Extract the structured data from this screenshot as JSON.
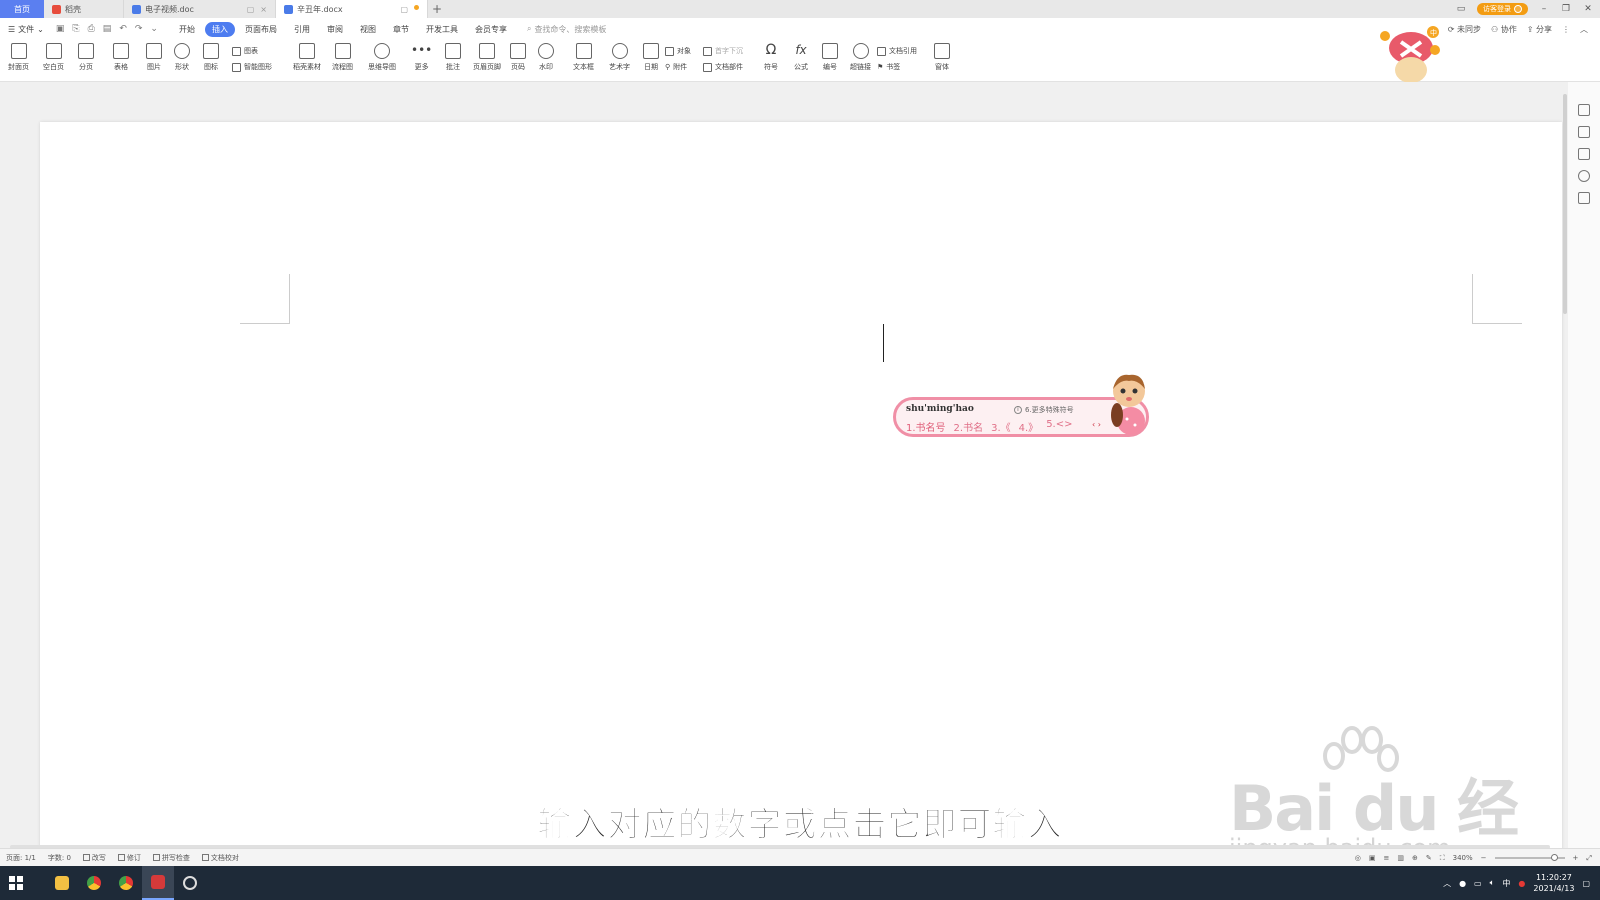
{
  "tabs": {
    "home": "首页",
    "shell": "稻壳",
    "doc1": "电子视频.doc",
    "active": "辛丑年.docx"
  },
  "titlebar": {
    "login": "访客登录"
  },
  "menu": {
    "file": "文件",
    "items": [
      "开始",
      "插入",
      "页面布局",
      "引用",
      "审阅",
      "视图",
      "章节",
      "开发工具",
      "会员专享"
    ],
    "active_index": 1,
    "search_placeholder": "查找命令、搜索模板",
    "right": [
      "未同步",
      "协作",
      "分享"
    ]
  },
  "ribbon": {
    "buttons": [
      "封面页",
      "空白页",
      "分页",
      "表格",
      "图片",
      "形状",
      "图标",
      "稻壳素材",
      "流程图",
      "思维导图",
      "更多",
      "批注",
      "页眉页脚",
      "页码",
      "水印",
      "文本框",
      "艺术字",
      "日期",
      "符号",
      "公式",
      "编号",
      "超链接",
      "窗体"
    ],
    "small": [
      "图表",
      "智能图形",
      "对象",
      "附件",
      "首字下沉",
      "文档部件",
      "文档引用",
      "书签"
    ]
  },
  "ime": {
    "pinyin": "shu'ming'hao",
    "more": "6.更多特殊符号",
    "candidates": [
      "1.书名号",
      "2.书名",
      "3.《",
      "4.》",
      "5.<>"
    ],
    "nav": "‹ ›"
  },
  "subtitle": "输入对应的数字或点击它即可输入",
  "watermark": {
    "brand": "Bai du 经验",
    "url": "jingyan.baidu.com"
  },
  "status": {
    "page": "页面: 1/1",
    "words": "字数: 0",
    "items": [
      "改写",
      "修订",
      "拼写检查",
      "文档校对"
    ],
    "zoom": "340%"
  },
  "taskbar": {
    "time": "11:20:27",
    "date": "2021/4/13",
    "ime": "中"
  },
  "colors": {
    "accent": "#4d7cf0",
    "ime_border": "#f08fa6",
    "taskbar": "#1e2a38",
    "login": "#f39c12"
  }
}
